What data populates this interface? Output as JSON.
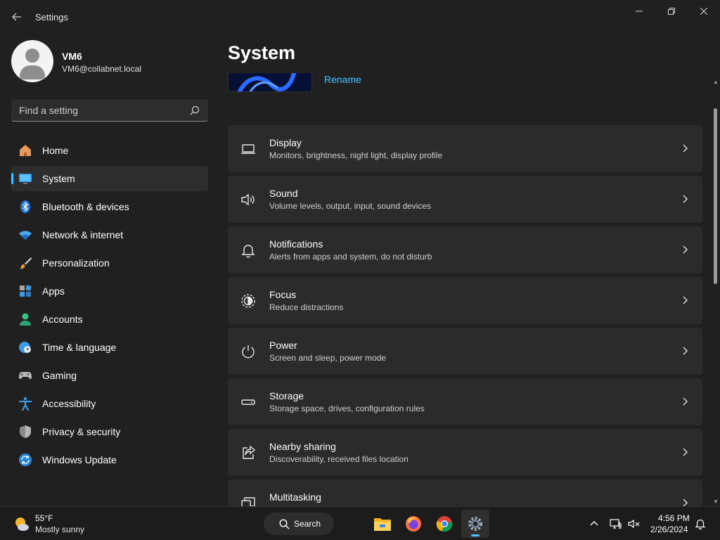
{
  "window": {
    "title": "Settings",
    "back_icon": "arrow-left-icon"
  },
  "profile": {
    "name": "VM6",
    "email": "VM6@collabnet.local"
  },
  "search": {
    "placeholder": "Find a setting"
  },
  "sidebar": {
    "items": [
      {
        "label": "Home",
        "icon": "home-icon"
      },
      {
        "label": "System",
        "icon": "monitor-icon",
        "active": true
      },
      {
        "label": "Bluetooth & devices",
        "icon": "bluetooth-icon"
      },
      {
        "label": "Network & internet",
        "icon": "wifi-icon"
      },
      {
        "label": "Personalization",
        "icon": "brush-icon"
      },
      {
        "label": "Apps",
        "icon": "apps-icon"
      },
      {
        "label": "Accounts",
        "icon": "person-icon"
      },
      {
        "label": "Time & language",
        "icon": "globe-clock-icon"
      },
      {
        "label": "Gaming",
        "icon": "gamepad-icon"
      },
      {
        "label": "Accessibility",
        "icon": "accessibility-icon"
      },
      {
        "label": "Privacy & security",
        "icon": "shield-icon"
      },
      {
        "label": "Windows Update",
        "icon": "update-icon"
      }
    ]
  },
  "main": {
    "title": "System",
    "rename_label": "Rename",
    "cards": [
      {
        "title": "Display",
        "desc": "Monitors, brightness, night light, display profile",
        "icon": "laptop-icon"
      },
      {
        "title": "Sound",
        "desc": "Volume levels, output, input, sound devices",
        "icon": "speaker-icon"
      },
      {
        "title": "Notifications",
        "desc": "Alerts from apps and system, do not disturb",
        "icon": "bell-icon"
      },
      {
        "title": "Focus",
        "desc": "Reduce distractions",
        "icon": "focus-icon"
      },
      {
        "title": "Power",
        "desc": "Screen and sleep, power mode",
        "icon": "power-icon"
      },
      {
        "title": "Storage",
        "desc": "Storage space, drives, configuration rules",
        "icon": "storage-icon"
      },
      {
        "title": "Nearby sharing",
        "desc": "Discoverability, received files location",
        "icon": "share-icon"
      },
      {
        "title": "Multitasking",
        "desc": "",
        "icon": "multitasking-icon"
      }
    ]
  },
  "taskbar": {
    "weather_temp": "55°F",
    "weather_desc": "Mostly sunny",
    "search_label": "Search",
    "apps": [
      "file-explorer-icon",
      "firefox-icon",
      "chrome-icon",
      "settings-icon"
    ],
    "clock_time": "4:56 PM",
    "clock_date": "2/26/2024"
  },
  "colors": {
    "accent": "#4cc2ff",
    "background": "#202020",
    "card": "#2b2b2b"
  }
}
